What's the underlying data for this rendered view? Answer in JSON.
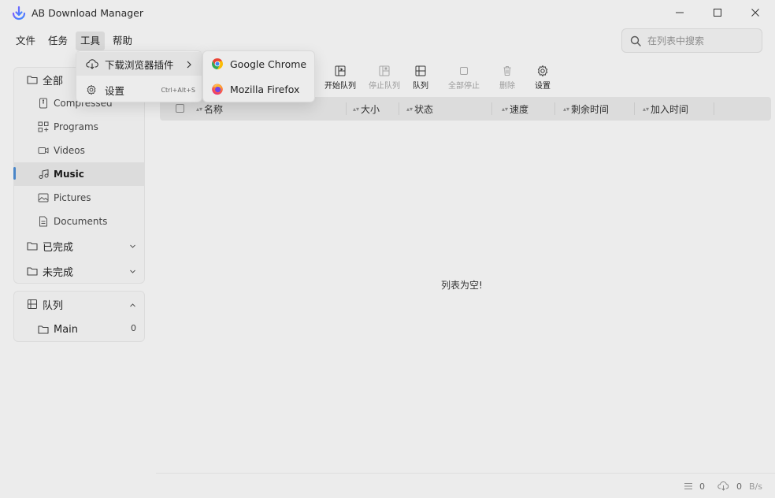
{
  "window": {
    "title": "AB Download Manager",
    "controls": [
      "minimize-icon",
      "maximize-icon",
      "close-icon"
    ]
  },
  "menubar": {
    "items": [
      "文件",
      "任务",
      "工具",
      "帮助"
    ],
    "active": "工具"
  },
  "search": {
    "placeholder": "在列表中搜索"
  },
  "sidebar": {
    "all": {
      "label": "全部",
      "categories": [
        {
          "label": "Compressed",
          "icon": "archive-icon"
        },
        {
          "label": "Programs",
          "icon": "apps-icon"
        },
        {
          "label": "Videos",
          "icon": "video-icon"
        },
        {
          "label": "Music",
          "icon": "music-icon",
          "selected": true
        },
        {
          "label": "Pictures",
          "icon": "image-icon"
        },
        {
          "label": "Documents",
          "icon": "document-icon"
        }
      ]
    },
    "completed": {
      "label": "已完成"
    },
    "unfinished": {
      "label": "未完成"
    },
    "queue": {
      "label": "队列",
      "items": [
        {
          "label": "Main",
          "count": "0"
        }
      ]
    }
  },
  "toolbar": {
    "start_queue": "开始队列",
    "stop_queue": "停止队列",
    "queue": "队列",
    "stop_all": "全部停止",
    "delete": "删除",
    "settings": "设置"
  },
  "table": {
    "columns": [
      "名称",
      "大小",
      "状态",
      "速度",
      "剩余时间",
      "加入时间"
    ],
    "empty_message": "列表为空!"
  },
  "status": {
    "active_count": "0",
    "speed_value": "0",
    "speed_unit": "B/s"
  },
  "tools_menu": {
    "browser_extension": "下载浏览器插件",
    "settings": "设置",
    "settings_shortcut": "Ctrl+Alt+S"
  },
  "browser_submenu": {
    "items": [
      "Google Chrome",
      "Mozilla Firefox"
    ]
  },
  "colors": {
    "accent": "#4a86c8",
    "background": "#ececec"
  }
}
